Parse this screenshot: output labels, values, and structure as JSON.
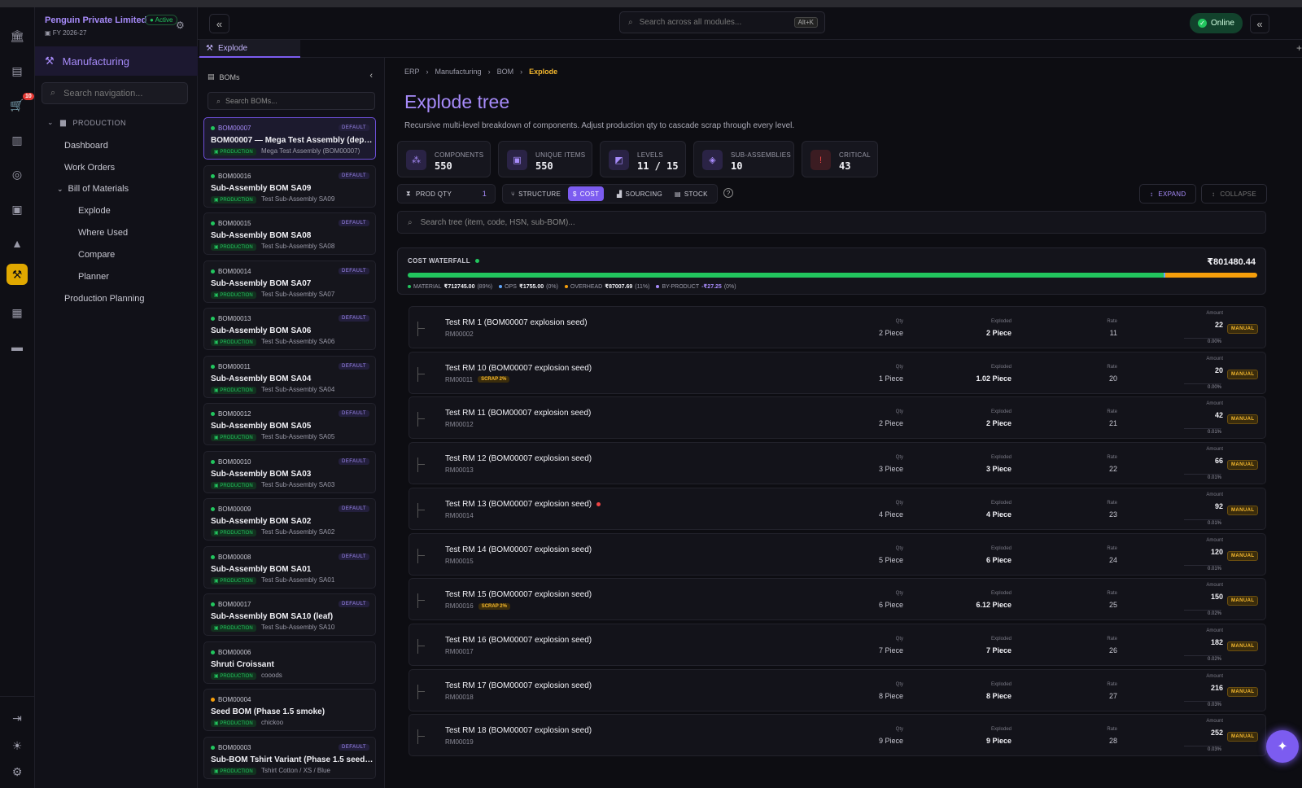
{
  "company": {
    "name": "Penguin Private Limited",
    "status": "Active",
    "fy": "FY 2026-27"
  },
  "rail": {
    "cart_badge": "10"
  },
  "module": {
    "title": "Manufacturing",
    "search_placeholder": "Search navigation..."
  },
  "nav": {
    "section": "PRODUCTION",
    "dashboard": "Dashboard",
    "work_orders": "Work Orders",
    "bom": "Bill of Materials",
    "explode": "Explode",
    "where_used": "Where Used",
    "compare": "Compare",
    "planner": "Planner",
    "production_planning": "Production Planning"
  },
  "header": {
    "search_placeholder": "Search across all modules...",
    "shortcut": "Alt+K",
    "status": "Online"
  },
  "tab": {
    "label": "Explode"
  },
  "bom_panel": {
    "title": "BOMs",
    "search_placeholder": "Search BOMs...",
    "items": [
      {
        "code": "BOM00007",
        "default": "DEFAULT",
        "name": "BOM00007 — Mega Test Assembly (depth ...",
        "tag": "PRODUCTION",
        "sub": "Mega Test Assembly (BOM00007)"
      },
      {
        "code": "BOM00016",
        "default": "DEFAULT",
        "name": "Sub-Assembly BOM SA09",
        "tag": "PRODUCTION",
        "sub": "Test Sub-Assembly SA09"
      },
      {
        "code": "BOM00015",
        "default": "DEFAULT",
        "name": "Sub-Assembly BOM SA08",
        "tag": "PRODUCTION",
        "sub": "Test Sub-Assembly SA08"
      },
      {
        "code": "BOM00014",
        "default": "DEFAULT",
        "name": "Sub-Assembly BOM SA07",
        "tag": "PRODUCTION",
        "sub": "Test Sub-Assembly SA07"
      },
      {
        "code": "BOM00013",
        "default": "DEFAULT",
        "name": "Sub-Assembly BOM SA06",
        "tag": "PRODUCTION",
        "sub": "Test Sub-Assembly SA06"
      },
      {
        "code": "BOM00011",
        "default": "DEFAULT",
        "name": "Sub-Assembly BOM SA04",
        "tag": "PRODUCTION",
        "sub": "Test Sub-Assembly SA04"
      },
      {
        "code": "BOM00012",
        "default": "DEFAULT",
        "name": "Sub-Assembly BOM SA05",
        "tag": "PRODUCTION",
        "sub": "Test Sub-Assembly SA05"
      },
      {
        "code": "BOM00010",
        "default": "DEFAULT",
        "name": "Sub-Assembly BOM SA03",
        "tag": "PRODUCTION",
        "sub": "Test Sub-Assembly SA03"
      },
      {
        "code": "BOM00009",
        "default": "DEFAULT",
        "name": "Sub-Assembly BOM SA02",
        "tag": "PRODUCTION",
        "sub": "Test Sub-Assembly SA02"
      },
      {
        "code": "BOM00008",
        "default": "DEFAULT",
        "name": "Sub-Assembly BOM SA01",
        "tag": "PRODUCTION",
        "sub": "Test Sub-Assembly SA01"
      },
      {
        "code": "BOM00017",
        "default": "DEFAULT",
        "name": "Sub-Assembly BOM SA10 (leaf)",
        "tag": "PRODUCTION",
        "sub": "Test Sub-Assembly SA10"
      },
      {
        "code": "BOM00006",
        "default": "",
        "name": "Shruti Croissant",
        "tag": "PRODUCTION",
        "sub": "cooods"
      },
      {
        "code": "BOM00004",
        "default": "",
        "name": "Seed BOM (Phase 1.5 smoke)",
        "tag": "PRODUCTION",
        "sub": "chickoo"
      },
      {
        "code": "BOM00003",
        "default": "DEFAULT",
        "name": "Sub-BOM Tshirt Variant (Phase 1.5 seed pr...",
        "tag": "PRODUCTION",
        "sub": "Tshirt Cotton / XS / Blue"
      }
    ]
  },
  "breadcrumb": [
    "ERP",
    "Manufacturing",
    "BOM",
    "Explode"
  ],
  "page": {
    "title": "Explode tree",
    "description": "Recursive multi-level breakdown of components. Adjust production qty to cascade scrap through every level."
  },
  "stats": [
    {
      "label": "COMPONENTS",
      "value": "550"
    },
    {
      "label": "UNIQUE ITEMS",
      "value": "550"
    },
    {
      "label": "LEVELS",
      "value": "11 / 15"
    },
    {
      "label": "SUB-ASSEMBLIES",
      "value": "10"
    },
    {
      "label": "CRITICAL",
      "value": "43"
    }
  ],
  "controls": {
    "prod_qty_label": "PROD QTY",
    "prod_qty_value": "1",
    "structure": "STRUCTURE",
    "cost": "COST",
    "sourcing": "SOURCING",
    "stock": "STOCK",
    "help": "?",
    "expand": "EXPAND",
    "collapse": "COLLAPSE",
    "tree_search_placeholder": "Search tree (item, code, HSN, sub-BOM)..."
  },
  "waterfall": {
    "title": "COST WATERFALL",
    "total": "₹801480.44",
    "legend": [
      {
        "label": "MATERIAL",
        "value": "₹712745.00",
        "pct": "(89%)",
        "color": "#22c55e",
        "share": 0.89
      },
      {
        "label": "OPS",
        "value": "₹1755.00",
        "pct": "(0%)",
        "color": "#60a5fa",
        "share": 0.002
      },
      {
        "label": "OVERHEAD",
        "value": "₹87007.69",
        "pct": "(11%)",
        "color": "#f59e0b",
        "share": 0.108
      },
      {
        "label": "BY-PRODUCT",
        "value": "-₹27.25",
        "pct": "(0%)",
        "color": "#a78bfa",
        "share": 0
      }
    ]
  },
  "columns": {
    "qty": "Qty",
    "exploded": "Exploded",
    "rate": "Rate",
    "amount": "Amount"
  },
  "rows": [
    {
      "name": "Test RM 1 (BOM00007 explosion seed)",
      "code": "RM00002",
      "scrap": "",
      "critical": false,
      "qty": "2 Piece",
      "exploded": "2 Piece",
      "rate": "11",
      "amount": "22",
      "badge": "MANUAL",
      "pct": "0.00%"
    },
    {
      "name": "Test RM 10 (BOM00007 explosion seed)",
      "code": "RM00011",
      "scrap": "SCRAP 2%",
      "critical": false,
      "qty": "1 Piece",
      "exploded": "1.02 Piece",
      "rate": "20",
      "amount": "20",
      "badge": "MANUAL",
      "pct": "0.00%"
    },
    {
      "name": "Test RM 11 (BOM00007 explosion seed)",
      "code": "RM00012",
      "scrap": "",
      "critical": false,
      "qty": "2 Piece",
      "exploded": "2 Piece",
      "rate": "21",
      "amount": "42",
      "badge": "MANUAL",
      "pct": "0.01%"
    },
    {
      "name": "Test RM 12 (BOM00007 explosion seed)",
      "code": "RM00013",
      "scrap": "",
      "critical": false,
      "qty": "3 Piece",
      "exploded": "3 Piece",
      "rate": "22",
      "amount": "66",
      "badge": "MANUAL",
      "pct": "0.01%"
    },
    {
      "name": "Test RM 13 (BOM00007 explosion seed)",
      "code": "RM00014",
      "scrap": "",
      "critical": true,
      "qty": "4 Piece",
      "exploded": "4 Piece",
      "rate": "23",
      "amount": "92",
      "badge": "MANUAL",
      "pct": "0.01%"
    },
    {
      "name": "Test RM 14 (BOM00007 explosion seed)",
      "code": "RM00015",
      "scrap": "",
      "critical": false,
      "qty": "5 Piece",
      "exploded": "6 Piece",
      "rate": "24",
      "amount": "120",
      "badge": "MANUAL",
      "pct": "0.01%"
    },
    {
      "name": "Test RM 15 (BOM00007 explosion seed)",
      "code": "RM00016",
      "scrap": "SCRAP 2%",
      "critical": false,
      "qty": "6 Piece",
      "exploded": "6.12 Piece",
      "rate": "25",
      "amount": "150",
      "badge": "MANUAL",
      "pct": "0.02%"
    },
    {
      "name": "Test RM 16 (BOM00007 explosion seed)",
      "code": "RM00017",
      "scrap": "",
      "critical": false,
      "qty": "7 Piece",
      "exploded": "7 Piece",
      "rate": "26",
      "amount": "182",
      "badge": "MANUAL",
      "pct": "0.02%"
    },
    {
      "name": "Test RM 17 (BOM00007 explosion seed)",
      "code": "RM00018",
      "scrap": "",
      "critical": false,
      "qty": "8 Piece",
      "exploded": "8 Piece",
      "rate": "27",
      "amount": "216",
      "badge": "MANUAL",
      "pct": "0.03%"
    },
    {
      "name": "Test RM 18 (BOM00007 explosion seed)",
      "code": "RM00019",
      "scrap": "",
      "critical": false,
      "qty": "9 Piece",
      "exploded": "9 Piece",
      "rate": "28",
      "amount": "252",
      "badge": "MANUAL",
      "pct": "0.03%"
    }
  ]
}
